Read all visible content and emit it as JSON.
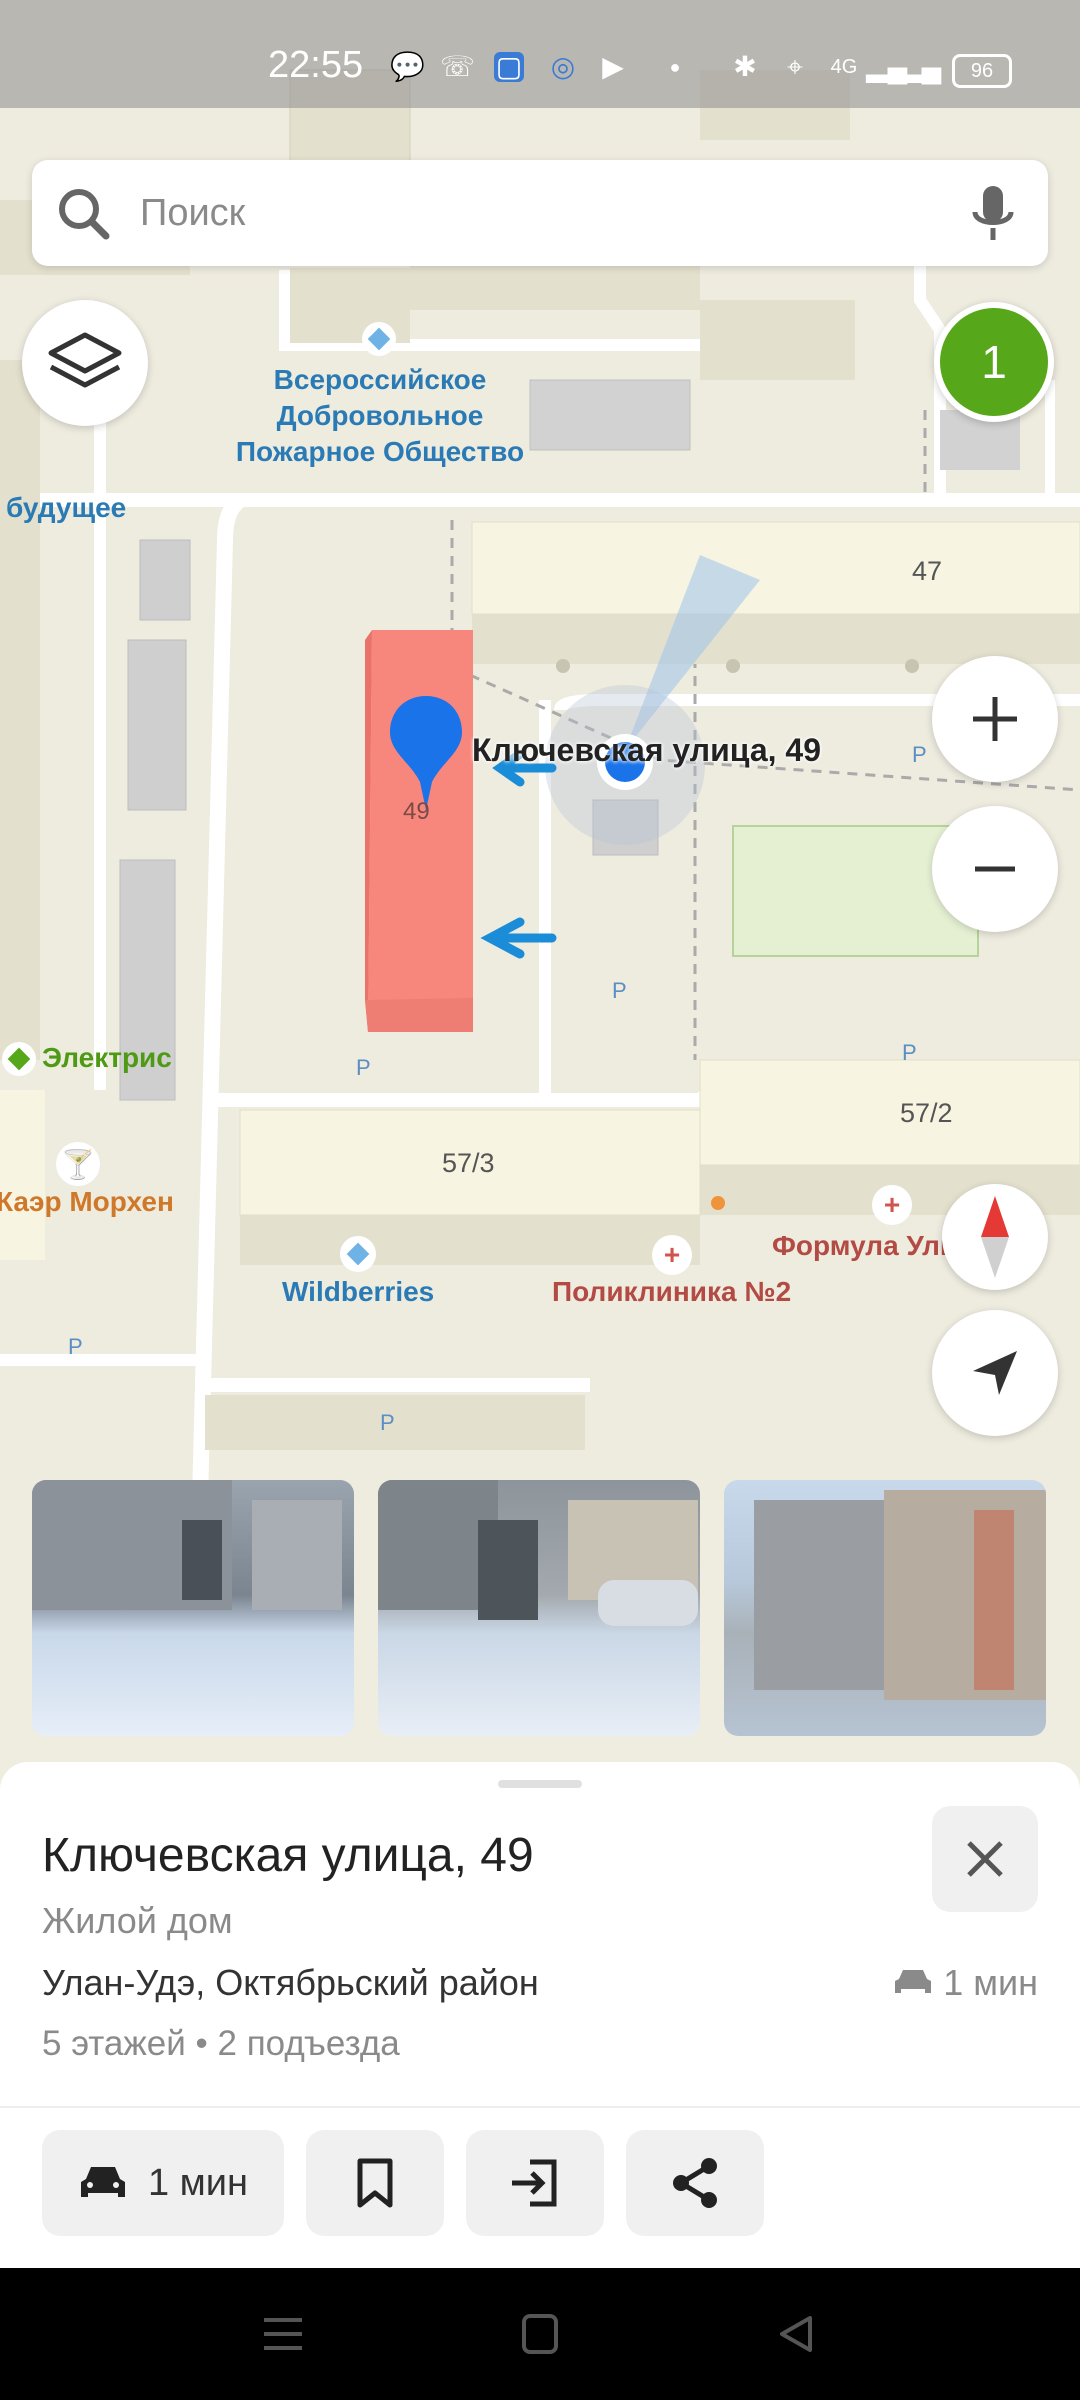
{
  "status_bar": {
    "time": "22:55",
    "network": "4G",
    "battery": "96"
  },
  "search": {
    "placeholder": "Поиск"
  },
  "map": {
    "poi_fire_society": "Всероссийское\nДобровольное\nПожарное Общество",
    "poi_future": "будущее",
    "poi_electric": "Электрис",
    "poi_bar": "Каэр Морхен",
    "poi_wildberries": "Wildberries",
    "poi_clinic": "Поликлиника №2",
    "poi_dental": "Формула Улыбки",
    "selected_label": "Ключевская улица, 49",
    "pin_number": "49",
    "building_47": "47",
    "building_57_2": "57/2",
    "building_57_3": "57/3",
    "parking": "P"
  },
  "badge": {
    "count": "1"
  },
  "place_card": {
    "title": "Ключевская улица, 49",
    "category": "Жилой дом",
    "address": "Улан-Удэ, Октябрьский район",
    "eta": "1 мин",
    "info": "5 этажей • 2 подъезда"
  },
  "actions": {
    "route_label": "1 мин"
  },
  "colors": {
    "accent_blue": "#1a73e8",
    "badge_green": "#57a71a",
    "selected_building": "#f7877c"
  }
}
